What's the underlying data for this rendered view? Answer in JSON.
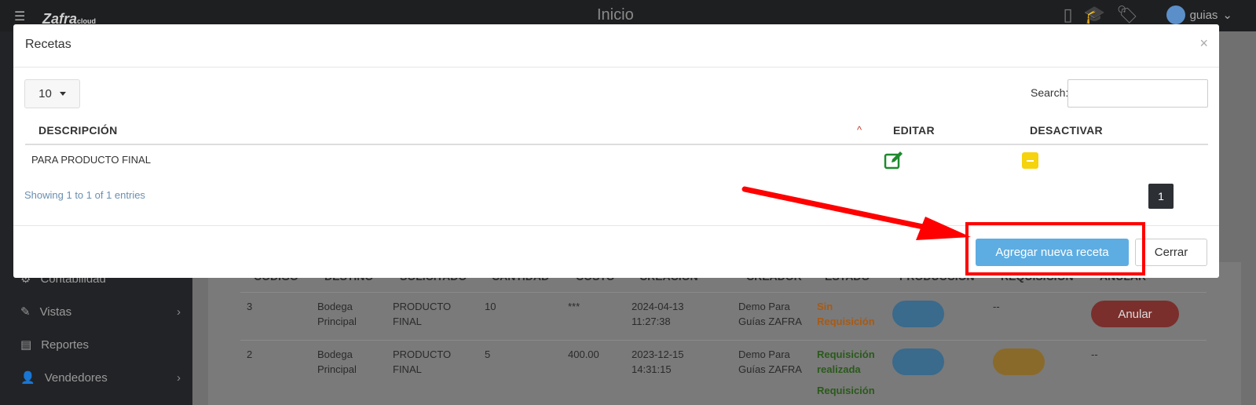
{
  "topbar": {
    "logo": "Zafra",
    "logo_suffix": "cloud",
    "page_title": "Inicio",
    "username": "guias"
  },
  "sidebar": {
    "items": [
      {
        "label": "Contabilidad",
        "icon": "gear-icon"
      },
      {
        "label": "Vistas",
        "icon": "edit-icon"
      },
      {
        "label": "Reportes",
        "icon": "list-icon"
      },
      {
        "label": "Vendedores",
        "icon": "user-icon"
      }
    ]
  },
  "background_table": {
    "headers": [
      "CODIGO",
      "DESTINO",
      "SOLICITADO",
      "CANTIDAD",
      "COSTO",
      "CREACIÓN",
      "CREADOR",
      "ESTADO",
      "PRODUCCIÓN",
      "REQUISICIÓN",
      "ANULAR"
    ],
    "rows": [
      {
        "codigo": "3",
        "destino": "Bodega Principal",
        "solicitado": "PRODUCTO FINAL",
        "cantidad": "10",
        "costo": "***",
        "creacion": "2024-04-13 11:27:38",
        "creador": "Demo Para Guías ZAFRA",
        "estado": "Sin Requisición",
        "requisicion": "--",
        "anular": "Anular"
      },
      {
        "codigo": "2",
        "destino": "Bodega Principal",
        "solicitado": "PRODUCTO FINAL",
        "cantidad": "5",
        "costo": "400.00",
        "creacion": "2023-12-15 14:31:15",
        "creador": "Demo Para Guías ZAFRA",
        "estado": "Requisición realizada",
        "estado_extra": "Requisición",
        "anular": "--"
      }
    ]
  },
  "modal": {
    "title": "Recetas",
    "close": "×",
    "page_length": "10",
    "search_label": "Search:",
    "search_value": "",
    "columns": {
      "descripcion": "DESCRIPCIÓN",
      "editar": "EDITAR",
      "desactivar": "DESACTIVAR"
    },
    "rows": [
      {
        "descripcion": "PARA PRODUCTO FINAL"
      }
    ],
    "info": "Showing 1 to 1 of 1 entries",
    "current_page": "1",
    "add_button": "Agregar nueva receta",
    "close_button": "Cerrar"
  },
  "colors": {
    "add_button": "#5dade2",
    "edit_icon": "#1e8a2e",
    "deactivate": "#f5d30d",
    "annotation": "#ff0000",
    "sort_icon": "#c0392b"
  }
}
